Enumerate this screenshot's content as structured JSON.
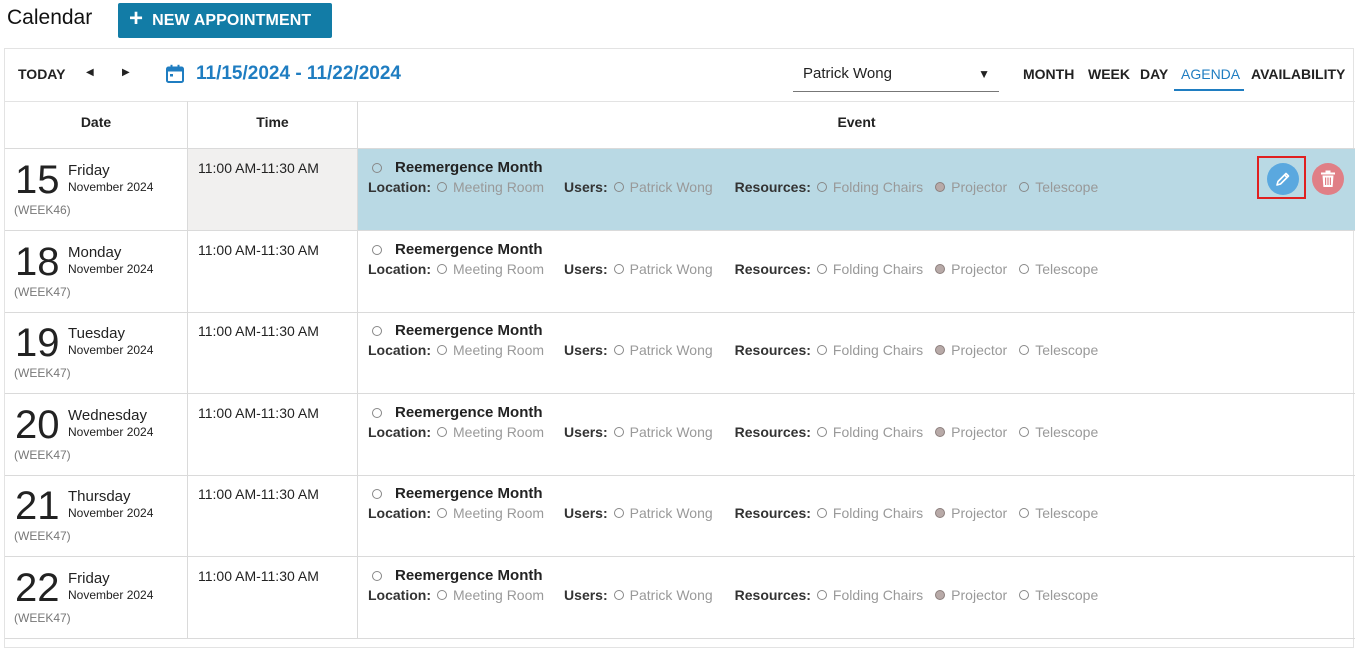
{
  "header": {
    "title": "Calendar",
    "new_button_label": "NEW APPOINTMENT"
  },
  "toolbar": {
    "today_label": "TODAY",
    "date_range": "11/15/2024 - 11/22/2024",
    "user_select_value": "Patrick Wong",
    "views": [
      "MONTH",
      "WEEK",
      "DAY",
      "AGENDA",
      "AVAILABILITY"
    ],
    "active_view": "AGENDA"
  },
  "columns": {
    "date": "Date",
    "time": "Time",
    "event": "Event"
  },
  "labels": {
    "location": "Location:",
    "users": "Users:",
    "resources": "Resources:"
  },
  "rows": [
    {
      "day": "15",
      "weekday": "Friday",
      "month": "November 2024",
      "week": "(WEEK46)",
      "time": "11:00 AM-11:30 AM",
      "title": "Reemergence Month",
      "location": "Meeting Room",
      "user": "Patrick Wong",
      "res1": "Folding Chairs",
      "res2": "Projector",
      "res3": "Telescope"
    },
    {
      "day": "18",
      "weekday": "Monday",
      "month": "November 2024",
      "week": "(WEEK47)",
      "time": "11:00 AM-11:30 AM",
      "title": "Reemergence Month",
      "location": "Meeting Room",
      "user": "Patrick Wong",
      "res1": "Folding Chairs",
      "res2": "Projector",
      "res3": "Telescope"
    },
    {
      "day": "19",
      "weekday": "Tuesday",
      "month": "November 2024",
      "week": "(WEEK47)",
      "time": "11:00 AM-11:30 AM",
      "title": "Reemergence Month",
      "location": "Meeting Room",
      "user": "Patrick Wong",
      "res1": "Folding Chairs",
      "res2": "Projector",
      "res3": "Telescope"
    },
    {
      "day": "20",
      "weekday": "Wednesday",
      "month": "November 2024",
      "week": "(WEEK47)",
      "time": "11:00 AM-11:30 AM",
      "title": "Reemergence Month",
      "location": "Meeting Room",
      "user": "Patrick Wong",
      "res1": "Folding Chairs",
      "res2": "Projector",
      "res3": "Telescope"
    },
    {
      "day": "21",
      "weekday": "Thursday",
      "month": "November 2024",
      "week": "(WEEK47)",
      "time": "11:00 AM-11:30 AM",
      "title": "Reemergence Month",
      "location": "Meeting Room",
      "user": "Patrick Wong",
      "res1": "Folding Chairs",
      "res2": "Projector",
      "res3": "Telescope"
    },
    {
      "day": "22",
      "weekday": "Friday",
      "month": "November 2024",
      "week": "(WEEK47)",
      "time": "11:00 AM-11:30 AM",
      "title": "Reemergence Month",
      "location": "Meeting Room",
      "user": "Patrick Wong",
      "res1": "Folding Chairs",
      "res2": "Projector",
      "res3": "Telescope"
    }
  ],
  "colors": {
    "accent": "#1f7dc1",
    "button": "#127ca6",
    "selected_row": "#b9d9e4",
    "edit": "#5aa8df",
    "delete": "#e07f86"
  },
  "icons": [
    "plus-icon",
    "chevron-left-icon",
    "chevron-right-icon",
    "calendar-icon",
    "dropdown-caret-icon",
    "radio-circle-icon",
    "pencil-icon",
    "trash-icon"
  ]
}
